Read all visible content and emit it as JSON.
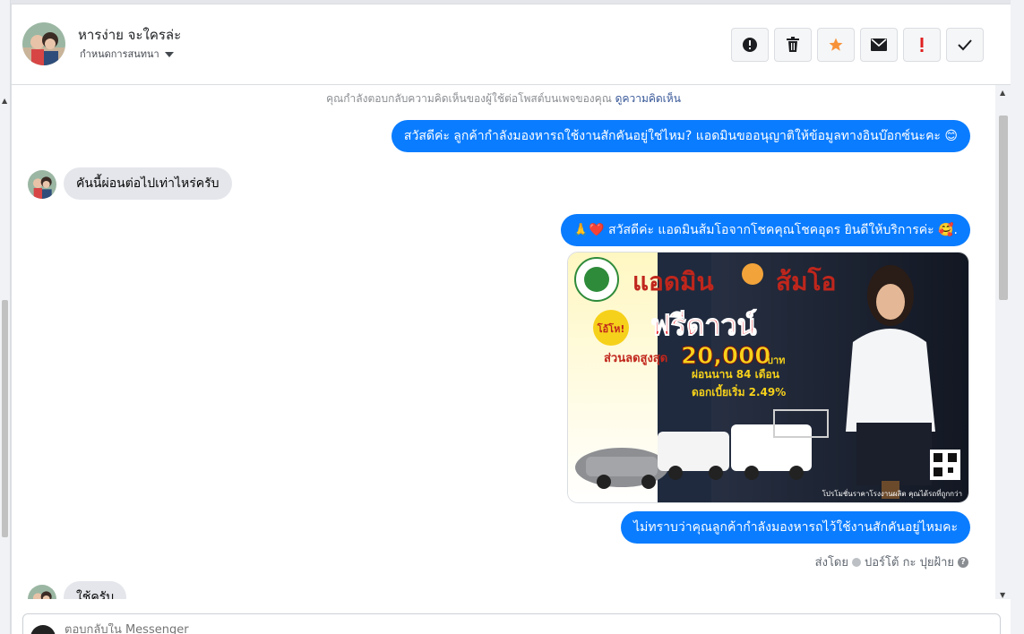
{
  "header": {
    "contact_name": "หารง่าย จะใครล่ะ",
    "assign_label": "กำหนดการสนทนา",
    "actions": [
      "alert-icon",
      "trash-icon",
      "star-icon",
      "mail-icon",
      "important-icon",
      "check-icon"
    ],
    "star_color": "#f7923a",
    "important_color": "#e02020"
  },
  "thread": {
    "notice_text": "คุณกำลังตอบกลับความคิดเห็นของผู้ใช้ต่อโพสต์บนเพจของคุณ",
    "notice_link": "ดูความคิดเห็น",
    "messages": [
      {
        "dir": "out",
        "text": "สวัสดีค่ะ ลูกค้ากำลังมองหารถใช้งานสักคันอยู่ใช่ไหม? แอดมินขออนุญาติให้ข้อมูลทางอินบ๊อกซ์นะคะ 😊"
      },
      {
        "dir": "in",
        "text": "คันนี้ผ่อนต่อไปเท่าไหร่ครับ"
      },
      {
        "dir": "out",
        "text": "🙏❤️ สวัสดีค่ะ แอดมินส้มโอจากโชคคุณโชคอุดร ยินดีให้บริการค่ะ 🥰."
      },
      {
        "dir": "out",
        "text": "ไม่ทราบว่าคุณลูกค้ากำลังมองหารถไว้ใช้งานสักคันอยู่ไหมคะ"
      },
      {
        "dir": "in",
        "text": "ใช้ครับ"
      }
    ],
    "sent_by_label": "ส่งโดย",
    "sent_by_name": "ปอร์โต้ กะ ปุยฝ้าย",
    "accent": "#0a7cff"
  },
  "promo": {
    "title_a": "แอดมิน",
    "title_b": "ส้มโอ",
    "badge": "โอ้โห!",
    "headline": "ฟรีดาวน์",
    "discount_label": "ส่วนลดสูงสุด",
    "discount_value": "20,000",
    "discount_unit": "บาท",
    "installment": "ผ่อนนาน 84 เดือน",
    "interest": "ดอกเบี้ยเริ่ม 2.49%",
    "footer": "โปรโมชั่นราคาโรงงานผลิต คุณได้รถที่ถูกกว่า"
  },
  "composer": {
    "placeholder": "ตอบกลับใน Messenger"
  }
}
